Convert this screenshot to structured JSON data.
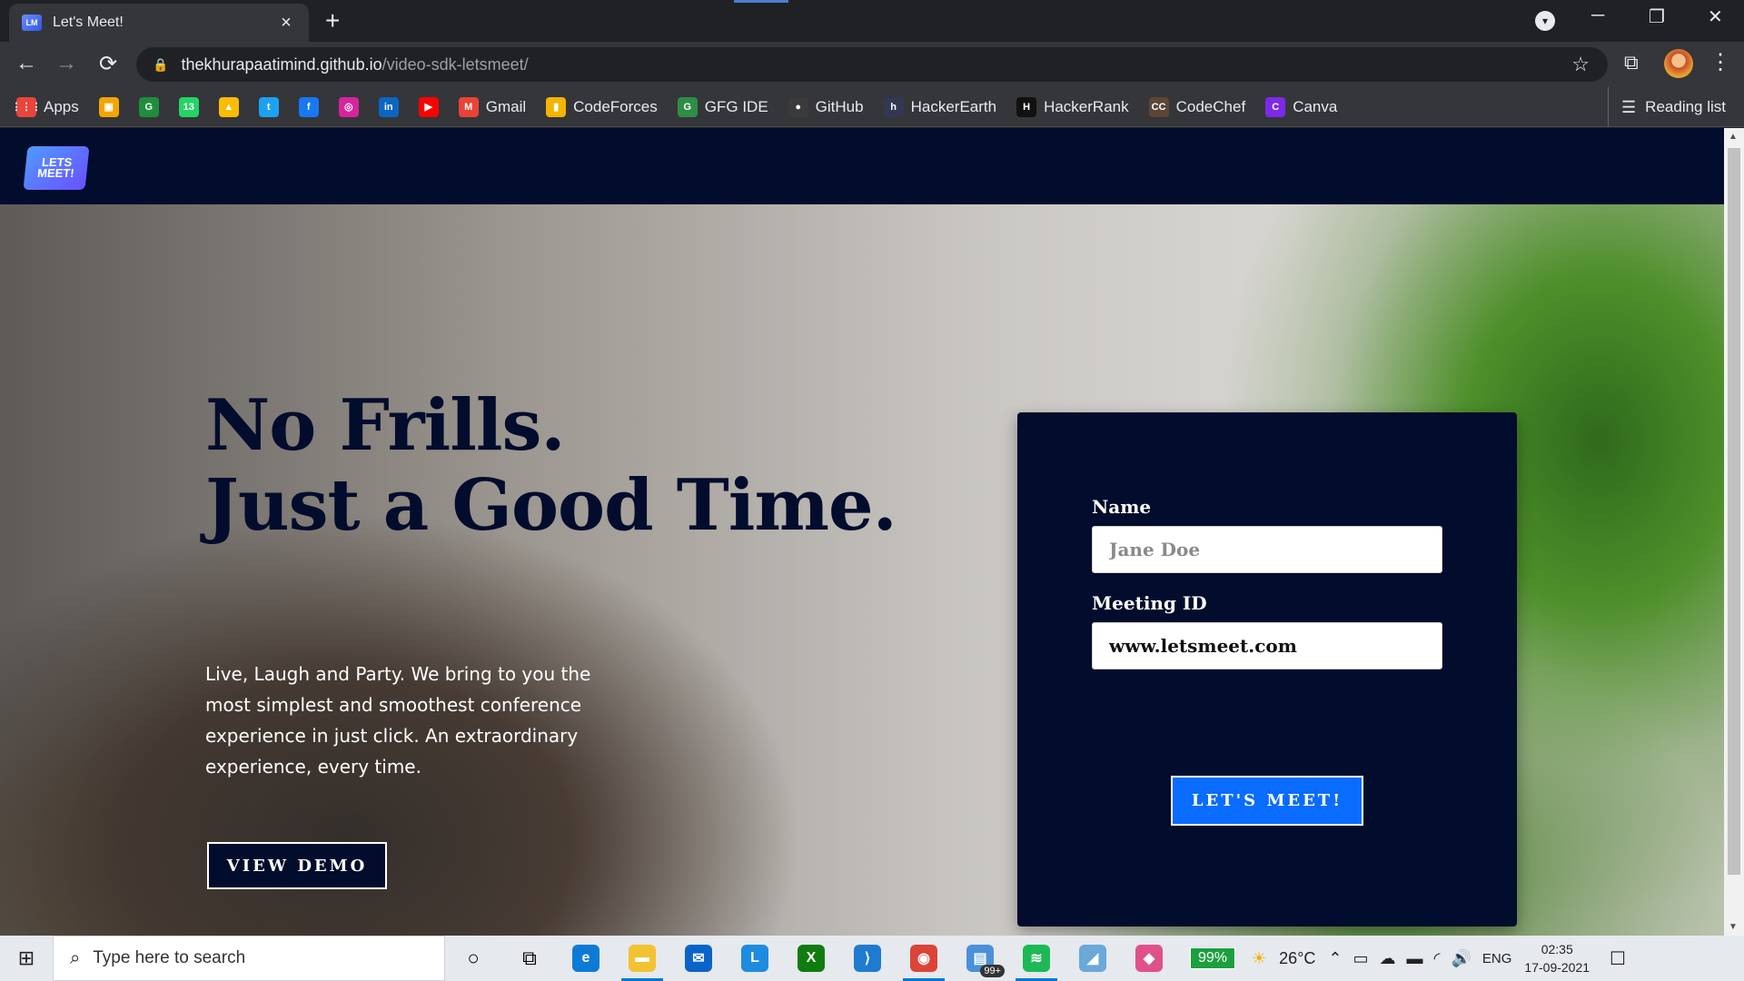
{
  "browser": {
    "tab_title": "Let's Meet!",
    "tab_favicon": "LM",
    "tab_close": "×",
    "new_tab": "+",
    "url_host": "thekhurapaatimind.github.io",
    "url_path": "/video-sdk-letsmeet/",
    "window_controls": {
      "minimize": "─",
      "restore": "❐",
      "close": "✕"
    },
    "profile_drop": "▾",
    "nav": {
      "back": "←",
      "forward": "→",
      "reload": "⟳"
    },
    "lock": "🔒",
    "star": "☆",
    "extensions": "⧉",
    "menu": "⋮",
    "reading_list_icon": "☰",
    "reading_list": "Reading list",
    "bookmarks": [
      {
        "label": "Apps",
        "icon": "apps-grid-icon",
        "glyph": "⋮⋮⋮",
        "color": "#e8453c"
      },
      {
        "label": "",
        "icon": "store-icon",
        "glyph": "▣",
        "color": "#f2a600"
      },
      {
        "label": "",
        "icon": "classroom-icon",
        "glyph": "G",
        "color": "#1e8e3e"
      },
      {
        "label": "",
        "icon": "whatsapp-icon",
        "glyph": "13",
        "color": "#25d366"
      },
      {
        "label": "",
        "icon": "drive-icon",
        "glyph": "▲",
        "color": "#fbbc04"
      },
      {
        "label": "",
        "icon": "twitter-icon",
        "glyph": "t",
        "color": "#1da1f2"
      },
      {
        "label": "",
        "icon": "facebook-icon",
        "glyph": "f",
        "color": "#1877f2"
      },
      {
        "label": "",
        "icon": "instagram-icon",
        "glyph": "◎",
        "color": "#d6249f"
      },
      {
        "label": "",
        "icon": "linkedin-icon",
        "glyph": "in",
        "color": "#0a66c2"
      },
      {
        "label": "",
        "icon": "youtube-icon",
        "glyph": "▶",
        "color": "#ff0000"
      },
      {
        "label": "Gmail",
        "icon": "gmail-icon",
        "glyph": "M",
        "color": "#ea4335"
      },
      {
        "label": "CodeForces",
        "icon": "codeforces-icon",
        "glyph": "▮",
        "color": "#f4b400"
      },
      {
        "label": "GFG IDE",
        "icon": "gfg-icon",
        "glyph": "G",
        "color": "#2f8d46"
      },
      {
        "label": "GitHub",
        "icon": "github-icon",
        "glyph": "●",
        "color": "#3a3a3a"
      },
      {
        "label": "HackerEarth",
        "icon": "hackerearth-icon",
        "glyph": "h",
        "color": "#323754"
      },
      {
        "label": "HackerRank",
        "icon": "hackerrank-icon",
        "glyph": "H",
        "color": "#111111"
      },
      {
        "label": "CodeChef",
        "icon": "codechef-icon",
        "glyph": "CC",
        "color": "#5b4638"
      },
      {
        "label": "Canva",
        "icon": "canva-icon",
        "glyph": "C",
        "color": "#7d2ae8"
      }
    ]
  },
  "site": {
    "logo_text": "LETS MEET!",
    "headline_line1": "No Frills.",
    "headline_line2": "Just a Good Time.",
    "subtext": "Live, Laugh and Party. We bring to you the most simplest and smoothest conference experience in just click. An extraordinary experience, every time.",
    "demo_button": "VIEW DEMO",
    "form": {
      "name_label": "Name",
      "name_placeholder": "Jane Doe",
      "meeting_label": "Meeting ID",
      "meeting_value": "www.letsmeet.com",
      "submit": "LET'S MEET!"
    }
  },
  "taskbar": {
    "start_icon": "⊞",
    "search_icon": "⌕",
    "search_placeholder": "Type here to search",
    "cortana": "○",
    "taskview": "⧉",
    "apps": [
      {
        "name": "edge-icon",
        "glyph": "e",
        "color": "#0c7bd6",
        "active": false
      },
      {
        "name": "file-explorer-icon",
        "glyph": "▬",
        "color": "#f2c230",
        "active": true
      },
      {
        "name": "mail-icon",
        "glyph": "✉",
        "color": "#0a64c8",
        "active": false
      },
      {
        "name": "l-app-icon",
        "glyph": "L",
        "color": "#1d8ce0",
        "active": false
      },
      {
        "name": "xbox-icon",
        "glyph": "X",
        "color": "#107c10",
        "active": false
      },
      {
        "name": "vscode-icon",
        "glyph": "⟩",
        "color": "#1f7bd0",
        "active": false
      },
      {
        "name": "chrome-icon",
        "glyph": "◉",
        "color": "#db4437",
        "active": true
      },
      {
        "name": "notepad-icon",
        "glyph": "▤",
        "color": "#4a90d9",
        "active": false
      },
      {
        "name": "spotify-icon",
        "glyph": "≋",
        "color": "#1db954",
        "active": true
      },
      {
        "name": "snip-icon",
        "glyph": "◢",
        "color": "#6aa9d8",
        "active": false
      },
      {
        "name": "game-icon",
        "glyph": "◆",
        "color": "#e0508a",
        "active": false
      }
    ],
    "notepad_badge": "99+",
    "battery": "99%",
    "weather_icon": "☀",
    "temperature": "26°C",
    "tray_icons": [
      "⌃",
      "▭",
      "☁",
      "▬",
      "◜",
      "🔊"
    ],
    "language": "ENG",
    "time": "02:35",
    "date": "17-09-2021",
    "notifications_icon": "☐"
  }
}
